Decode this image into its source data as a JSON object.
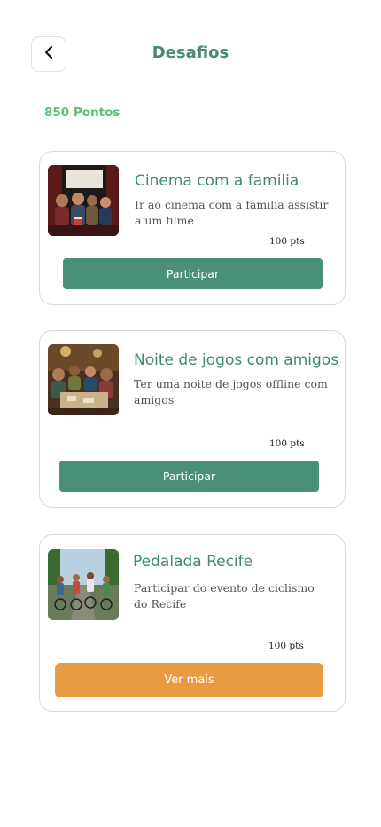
{
  "header": {
    "title": "Desafios",
    "back_icon": "chevron-left-icon"
  },
  "points_label": "850 Pontos",
  "colors": {
    "brand_green": "#4a8f77",
    "points_green": "#5cc07a",
    "orange": "#e89b41"
  },
  "challenges": [
    {
      "title": "Cinema com a familia",
      "description": "Ir ao cinema com a familia assistir a um filme",
      "points": "100 pts",
      "button_label": "Participar",
      "image": "family-cinema-photo"
    },
    {
      "title": "Noite de jogos com amigos",
      "description": "Ter uma noite de jogos offline com amigos",
      "points": "100 pts",
      "button_label": "Participar",
      "image": "board-game-night-photo"
    },
    {
      "title": "Pedalada Recife",
      "description": "Participar do evento de ciclismo do Recife",
      "points": "100 pts",
      "button_label": "Ver mais",
      "image": "cycling-group-photo"
    }
  ]
}
